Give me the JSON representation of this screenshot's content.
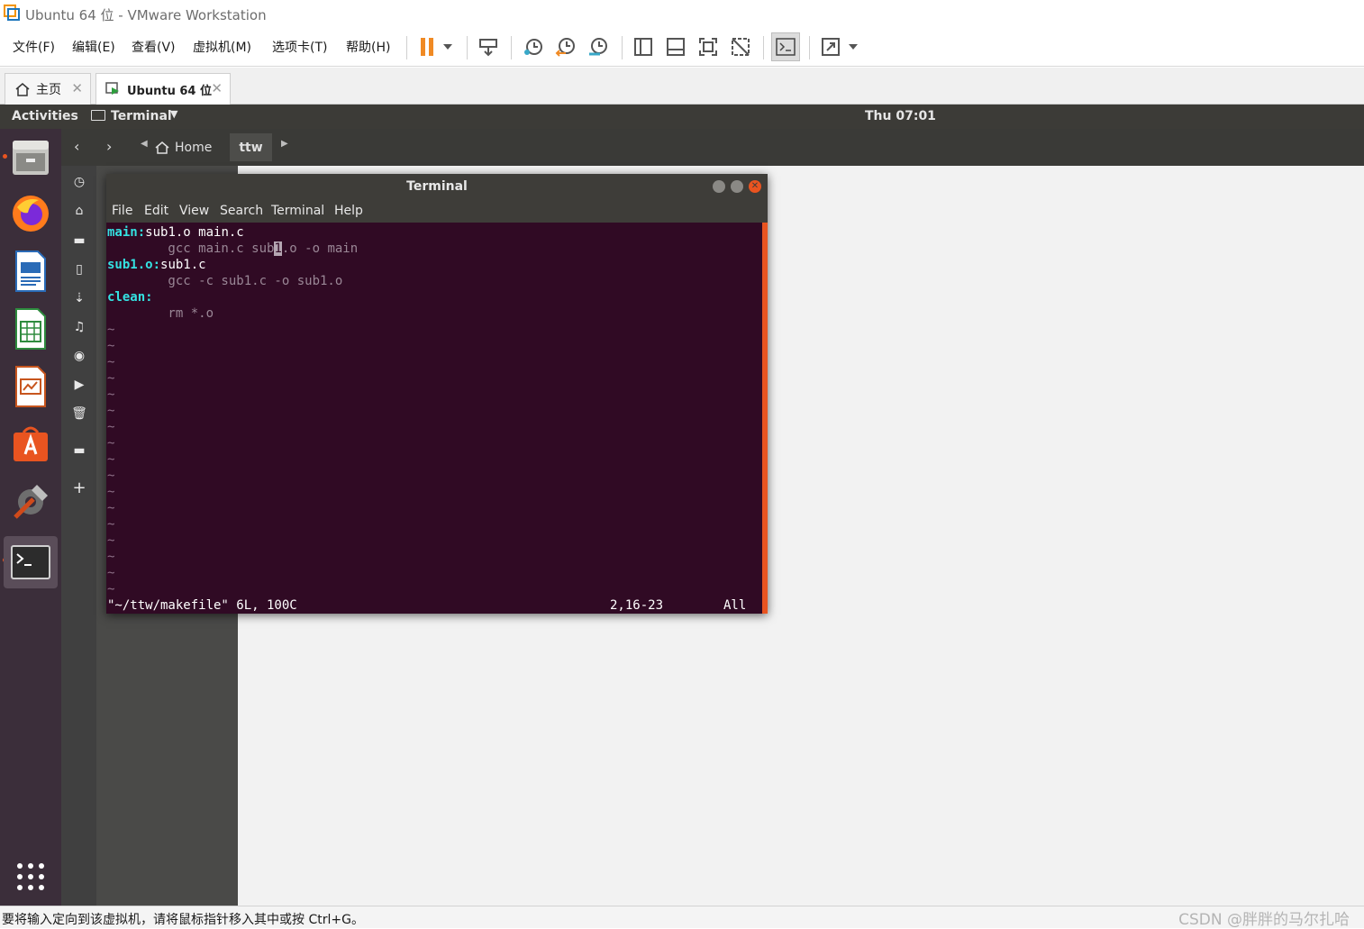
{
  "window": {
    "title": "Ubuntu 64 位 - VMware Workstation"
  },
  "menubar": {
    "file": "文件(F)",
    "edit": "编辑(E)",
    "view": "查看(V)",
    "vm": "虚拟机(M)",
    "tabs": "选项卡(T)",
    "help": "帮助(H)"
  },
  "toolbar": {
    "icons": [
      "pause-icon",
      "dropdown-arrow-icon",
      "send-ctrl-alt-del-icon",
      "snapshot-icon",
      "revert-snapshot-icon",
      "snapshot-manager-icon",
      "library-view-icon",
      "thumbnail-bar-icon",
      "full-screen-icon",
      "unity-icon",
      "console-view-icon",
      "stretch-icon"
    ]
  },
  "tabs": [
    {
      "label": "主页",
      "icon": "home-icon",
      "active": false
    },
    {
      "label": "Ubuntu 64 位",
      "icon": "vm-icon",
      "active": true
    }
  ],
  "ubuntu_topbar": {
    "activities": "Activities",
    "app_menu": "Terminal",
    "clock": "Thu 07:01"
  },
  "dock": {
    "items": [
      "files-icon",
      "firefox-icon",
      "writer-icon",
      "calc-icon",
      "impress-icon",
      "software-icon",
      "settings-icon",
      "terminal-icon"
    ],
    "apps_grid": "show-applications-icon"
  },
  "nautilus": {
    "breadcrumb_home": "Home",
    "breadcrumb_current": "ttw"
  },
  "terminal": {
    "title": "Terminal",
    "menu": [
      "File",
      "Edit",
      "View",
      "Search",
      "Terminal",
      "Help"
    ],
    "lines": {
      "l1_target": "main:",
      "l1_deps": "sub1.o main.c",
      "l2_pre": "        gcc main.c sub",
      "l2_cursor": "1",
      "l2_post": ".o -o main",
      "l3_target": "sub1.o:",
      "l3_deps": "sub1.c",
      "l4": "        gcc -c sub1.c -o sub1.o",
      "l5_target": "clean:",
      "l6": "        rm *.o",
      "tilde": "~"
    },
    "status_left": "\"~/ttw/makefile\" 6L, 100C",
    "status_pos": "2,16-23",
    "status_right": "All",
    "colors": {
      "background": "#300a24",
      "keyword": "#34e2e2",
      "accent": "#e95420"
    }
  },
  "statusbar": {
    "text": "要将输入定向到该虚拟机，请将鼠标指针移入其中或按 Ctrl+G。",
    "watermark": "CSDN @胖胖的马尔扎哈"
  }
}
